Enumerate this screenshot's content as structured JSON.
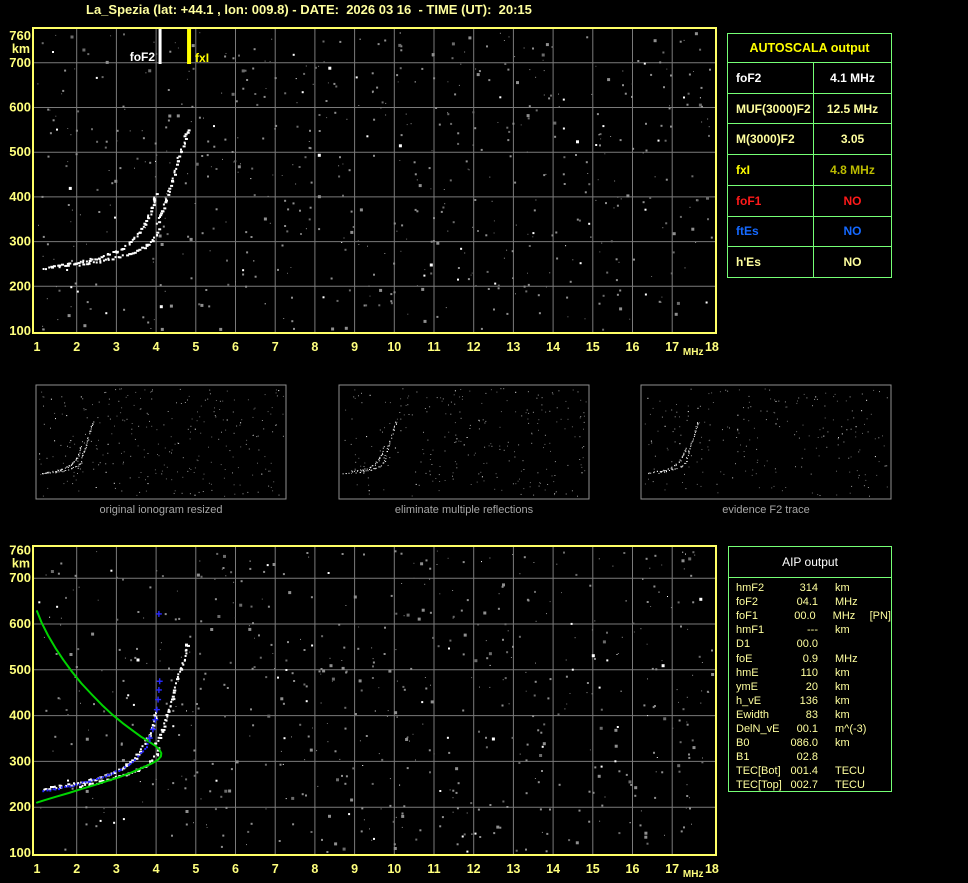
{
  "title": "La_Spezia (lat: +44.1 , lon: 009.8) - DATE:  2026 03 16  - TIME (UT):  20:15",
  "colors": {
    "background": "#000000",
    "plot_border": "#ffff66",
    "axis_text": "#ffff7d",
    "grid": "#7a7a7a",
    "trace": "#ffffff",
    "profile_green": "#00d400",
    "fit_blue": "#2828ff",
    "table_border": "#75ff75",
    "pale_yellow": "#ffff9e",
    "bright_yellow": "#ffff00",
    "red": "#ff1a1a",
    "blue": "#1569ff",
    "thumb_border": "#909090",
    "caption_gray": "#a6a6a6"
  },
  "autoscala_table": {
    "header": "AUTOSCALA output",
    "rows": [
      {
        "label": "foF2",
        "value": "4.1 MHz",
        "label_color": "#ffffff",
        "value_color": "#ffffff"
      },
      {
        "label": "MUF(3000)F2",
        "value": "12.5 MHz",
        "label_color": "#ffff9e",
        "value_color": "#ffff9e"
      },
      {
        "label": "M(3000)F2",
        "value": "3.05",
        "label_color": "#ffff9e",
        "value_color": "#ffff9e"
      },
      {
        "label": "fxI",
        "value": "4.8 MHz",
        "label_color": "#ffff00",
        "value_color": "#bcbc00"
      },
      {
        "label": "foF1",
        "value": "NO",
        "label_color": "#ff1a1a",
        "value_color": "#ff1a1a"
      },
      {
        "label": "ftEs",
        "value": "NO",
        "label_color": "#1569ff",
        "value_color": "#1569ff"
      },
      {
        "label": "h'Es",
        "value": "NO",
        "label_color": "#ffff9e",
        "value_color": "#ffff9e"
      }
    ]
  },
  "aip_table": {
    "header": "AIP output",
    "rows": [
      {
        "label": "hmF2",
        "value": "314",
        "unit": "km",
        "extra": ""
      },
      {
        "label": "foF2",
        "value": "04.1",
        "unit": "MHz",
        "extra": ""
      },
      {
        "label": "foF1",
        "value": "00.0",
        "unit": "MHz",
        "extra": "[PN]"
      },
      {
        "label": "hmF1",
        "value": "---",
        "unit": "km",
        "extra": ""
      },
      {
        "label": "D1",
        "value": "00.0",
        "unit": "",
        "extra": ""
      },
      {
        "label": "foE",
        "value": "0.9",
        "unit": "MHz",
        "extra": ""
      },
      {
        "label": "hmE",
        "value": "110",
        "unit": "km",
        "extra": ""
      },
      {
        "label": "ymE",
        "value": "20",
        "unit": "km",
        "extra": ""
      },
      {
        "label": "h_vE",
        "value": "136",
        "unit": "km",
        "extra": ""
      },
      {
        "label": "Ewidth",
        "value": "83",
        "unit": "km",
        "extra": ""
      },
      {
        "label": "DelN_vE",
        "value": "00.1",
        "unit": "m^(-3)",
        "extra": ""
      },
      {
        "label": "B0",
        "value": "086.0",
        "unit": "km",
        "extra": ""
      },
      {
        "label": "B1",
        "value": "02.8",
        "unit": "",
        "extra": ""
      },
      {
        "label": "TEC[Bot]",
        "value": "001.4",
        "unit": "TECU",
        "extra": ""
      },
      {
        "label": "TEC[Top]",
        "value": "002.7",
        "unit": "TECU",
        "extra": ""
      }
    ]
  },
  "thumbnails": [
    {
      "caption": "original ionogram resized"
    },
    {
      "caption": "eliminate multiple reflections"
    },
    {
      "caption": "evidence F2 trace"
    }
  ],
  "chart_data": [
    {
      "id": "ionogram_autoscala",
      "type": "scatter",
      "xlabel": "MHz",
      "ylabel": "km",
      "xlim": [
        1,
        18
      ],
      "ylim": [
        100,
        760
      ],
      "xticks": [
        1,
        2,
        3,
        4,
        5,
        6,
        7,
        8,
        9,
        10,
        11,
        12,
        13,
        14,
        15,
        16,
        17,
        18
      ],
      "yticks": [
        100,
        200,
        300,
        400,
        500,
        600,
        700,
        760
      ],
      "grid": true,
      "series": [
        {
          "name": "o-mode-echo-trace",
          "color": "#ffffff",
          "style": "blob",
          "points": [
            [
              1.15,
              241
            ],
            [
              1.35,
              244
            ],
            [
              1.55,
              247
            ],
            [
              1.75,
              250
            ],
            [
              1.95,
              253
            ],
            [
              2.15,
              257
            ],
            [
              2.35,
              261
            ],
            [
              2.55,
              266
            ],
            [
              2.75,
              272
            ],
            [
              2.95,
              279
            ],
            [
              3.15,
              288
            ],
            [
              3.3,
              298
            ],
            [
              3.45,
              310
            ],
            [
              3.58,
              324
            ],
            [
              3.7,
              340
            ],
            [
              3.8,
              358
            ],
            [
              3.88,
              378
            ],
            [
              3.94,
              396
            ],
            [
              3.97,
              407
            ]
          ]
        },
        {
          "name": "x-mode-echo-trace-lower",
          "color": "#ffffff",
          "style": "blob",
          "points": [
            [
              2.05,
              248
            ],
            [
              2.3,
              252
            ],
            [
              2.55,
              257
            ],
            [
              2.8,
              262
            ],
            [
              3.05,
              268
            ],
            [
              3.3,
              275
            ],
            [
              3.55,
              283
            ],
            [
              3.75,
              293
            ],
            [
              3.9,
              304
            ],
            [
              4.0,
              317
            ],
            [
              4.05,
              330
            ]
          ]
        },
        {
          "name": "x-mode-echo-trace-upper",
          "color": "#ffffff",
          "style": "blob",
          "points": [
            [
              3.98,
              341
            ],
            [
              4.06,
              355
            ],
            [
              4.14,
              372
            ],
            [
              4.22,
              392
            ],
            [
              4.3,
              414
            ],
            [
              4.38,
              436
            ],
            [
              4.45,
              458
            ],
            [
              4.52,
              480
            ],
            [
              4.6,
              502
            ],
            [
              4.68,
              524
            ],
            [
              4.74,
              543
            ],
            [
              4.77,
              553
            ]
          ]
        }
      ],
      "markers": [
        {
          "label": "foF2",
          "freq": 4.1,
          "color": "#ffffff",
          "side": "left"
        },
        {
          "label": "fxI",
          "freq": 4.83,
          "color": "#ffff00",
          "side": "right"
        }
      ]
    },
    {
      "id": "ionogram_aip",
      "type": "scatter",
      "xlabel": "MHz",
      "ylabel": "km",
      "xlim": [
        1,
        18
      ],
      "ylim": [
        100,
        760
      ],
      "xticks": [
        1,
        2,
        3,
        4,
        5,
        6,
        7,
        8,
        9,
        10,
        11,
        12,
        13,
        14,
        15,
        16,
        17,
        18
      ],
      "yticks": [
        100,
        200,
        300,
        400,
        500,
        600,
        700,
        760
      ],
      "grid": true,
      "series": [
        {
          "name": "o-mode-echo-trace",
          "color": "#ffffff",
          "style": "blob",
          "points": [
            [
              1.15,
              241
            ],
            [
              1.35,
              244
            ],
            [
              1.55,
              247
            ],
            [
              1.75,
              250
            ],
            [
              1.95,
              253
            ],
            [
              2.15,
              257
            ],
            [
              2.35,
              261
            ],
            [
              2.55,
              266
            ],
            [
              2.75,
              272
            ],
            [
              2.95,
              279
            ],
            [
              3.15,
              288
            ],
            [
              3.3,
              298
            ],
            [
              3.45,
              310
            ],
            [
              3.58,
              324
            ],
            [
              3.7,
              340
            ],
            [
              3.8,
              358
            ],
            [
              3.88,
              378
            ],
            [
              3.94,
              396
            ],
            [
              3.97,
              407
            ]
          ]
        },
        {
          "name": "x-mode-echo-trace-lower",
          "color": "#ffffff",
          "style": "blob",
          "points": [
            [
              2.05,
              248
            ],
            [
              2.3,
              252
            ],
            [
              2.55,
              257
            ],
            [
              2.8,
              262
            ],
            [
              3.05,
              268
            ],
            [
              3.3,
              275
            ],
            [
              3.55,
              283
            ],
            [
              3.75,
              293
            ],
            [
              3.9,
              304
            ],
            [
              4.0,
              317
            ],
            [
              4.05,
              330
            ]
          ]
        },
        {
          "name": "x-mode-echo-trace-upper",
          "color": "#ffffff",
          "style": "blob",
          "points": [
            [
              3.98,
              341
            ],
            [
              4.06,
              355
            ],
            [
              4.14,
              372
            ],
            [
              4.22,
              392
            ],
            [
              4.3,
              414
            ],
            [
              4.38,
              436
            ],
            [
              4.45,
              458
            ],
            [
              4.52,
              480
            ],
            [
              4.6,
              502
            ],
            [
              4.68,
              524
            ],
            [
              4.74,
              543
            ],
            [
              4.77,
              553
            ]
          ]
        },
        {
          "name": "electron-density-profile",
          "color": "#00d400",
          "style": "line",
          "points": [
            [
              1.0,
              628
            ],
            [
              1.12,
              602
            ],
            [
              1.28,
              575
            ],
            [
              1.46,
              548
            ],
            [
              1.66,
              522
            ],
            [
              1.88,
              496
            ],
            [
              2.12,
              470
            ],
            [
              2.38,
              446
            ],
            [
              2.64,
              423
            ],
            [
              2.9,
              402
            ],
            [
              3.15,
              384
            ],
            [
              3.4,
              368
            ],
            [
              3.62,
              354
            ],
            [
              3.82,
              343
            ],
            [
              3.98,
              334
            ],
            [
              4.08,
              326
            ],
            [
              4.13,
              318
            ],
            [
              4.12,
              311
            ],
            [
              4.04,
              303
            ],
            [
              3.88,
              295
            ],
            [
              3.65,
              286
            ],
            [
              3.38,
              276
            ],
            [
              3.08,
              266
            ],
            [
              2.76,
              257
            ],
            [
              2.44,
              248
            ],
            [
              2.12,
              240
            ],
            [
              1.8,
              231
            ],
            [
              1.48,
              223
            ],
            [
              1.18,
              215
            ],
            [
              1.0,
              210
            ]
          ]
        },
        {
          "name": "restored-o-trace-fit",
          "color": "#2828ff",
          "style": "dotted-plus",
          "plus_above_km": 345,
          "points": [
            [
              1.15,
              236
            ],
            [
              1.38,
              240
            ],
            [
              1.6,
              244
            ],
            [
              1.82,
              248
            ],
            [
              2.04,
              253
            ],
            [
              2.26,
              258
            ],
            [
              2.48,
              263
            ],
            [
              2.7,
              269
            ],
            [
              2.9,
              276
            ],
            [
              3.1,
              284
            ],
            [
              3.28,
              294
            ],
            [
              3.45,
              306
            ],
            [
              3.6,
              319
            ],
            [
              3.73,
              334
            ],
            [
              3.84,
              351
            ],
            [
              3.92,
              370
            ],
            [
              3.98,
              391
            ],
            [
              4.02,
              413
            ],
            [
              4.05,
              435
            ],
            [
              4.07,
              456
            ],
            [
              4.09,
              475
            ],
            [
              4.11,
              492
            ]
          ],
          "isolated_points": [
            [
              4.07,
              622
            ]
          ]
        },
        {
          "name": "hmF2-peak",
          "color": "#00d400",
          "style": "none",
          "points": [
            [
              4.1,
              314
            ]
          ]
        }
      ],
      "markers": []
    }
  ]
}
